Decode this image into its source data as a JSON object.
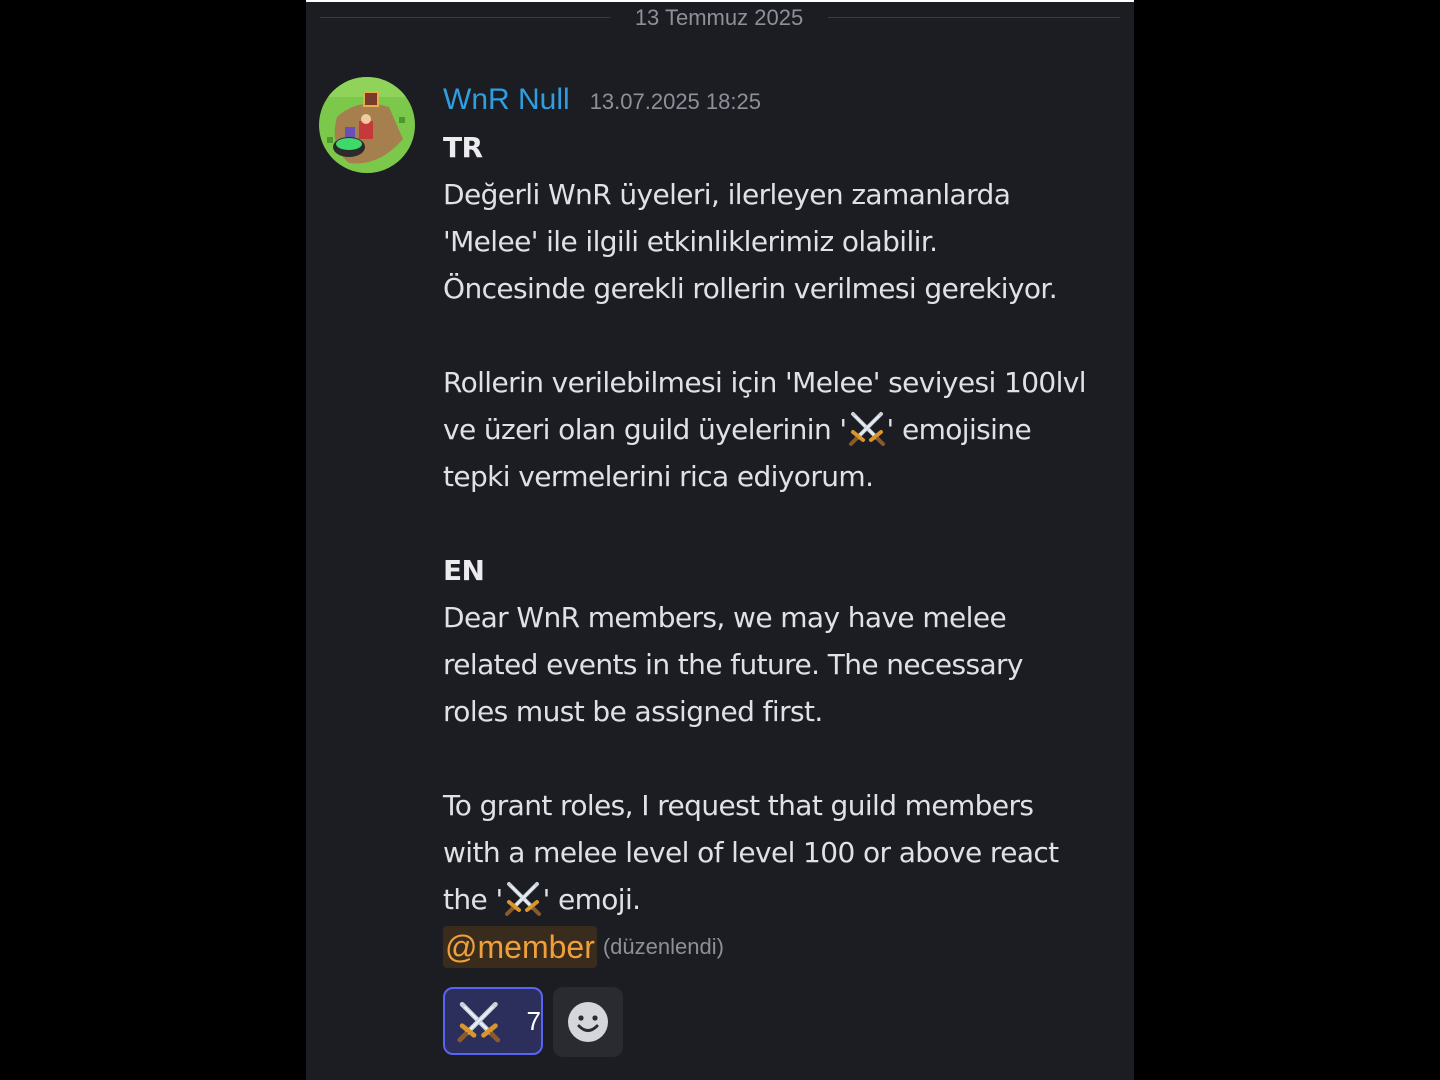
{
  "divider": {
    "date": "13 Temmuz 2025"
  },
  "message": {
    "author": "WnR Null",
    "timestamp": "13.07.2025 18:25",
    "lines": {
      "tr_heading": "TR",
      "l1": "Değerli WnR üyeleri, ilerleyen zamanlarda",
      "l2": "'Melee' ile ilgili etkinliklerimiz olabilir.",
      "l3": "Öncesinde gerekli rollerin verilmesi gerekiyor.",
      "l4": "Rollerin verilebilmesi için 'Melee' seviyesi 100lvl",
      "l5a": "ve üzeri olan guild üyelerinin '",
      "l5b": "'  emojisine",
      "l6": "tepki vermelerini rica ediyorum.",
      "en_heading": "EN",
      "l7": "Dear WnR members, we may have melee",
      "l8": "related events in the future. The necessary",
      "l9": "roles must be assigned first.",
      "l10": "To grant roles, I request that guild members",
      "l11": "with a melee level of level 100 or above react",
      "l12a": "the '",
      "l12b": "' emoji."
    },
    "mention": "@member",
    "edited": "(düzenlendi)",
    "inline_emoji": "crossed-swords-icon",
    "reactions": [
      {
        "emoji": "crossed-swords-icon",
        "count": "7",
        "reacted_by_me": true
      }
    ],
    "add_reaction_icon": "smiley-icon"
  },
  "colors": {
    "background": "#1c1d22",
    "author": "#2f9de2",
    "mention_text": "#f0a03a",
    "mention_bg": "#3a2c1c",
    "reaction_border": "#5865f2",
    "muted": "#8e9099"
  }
}
